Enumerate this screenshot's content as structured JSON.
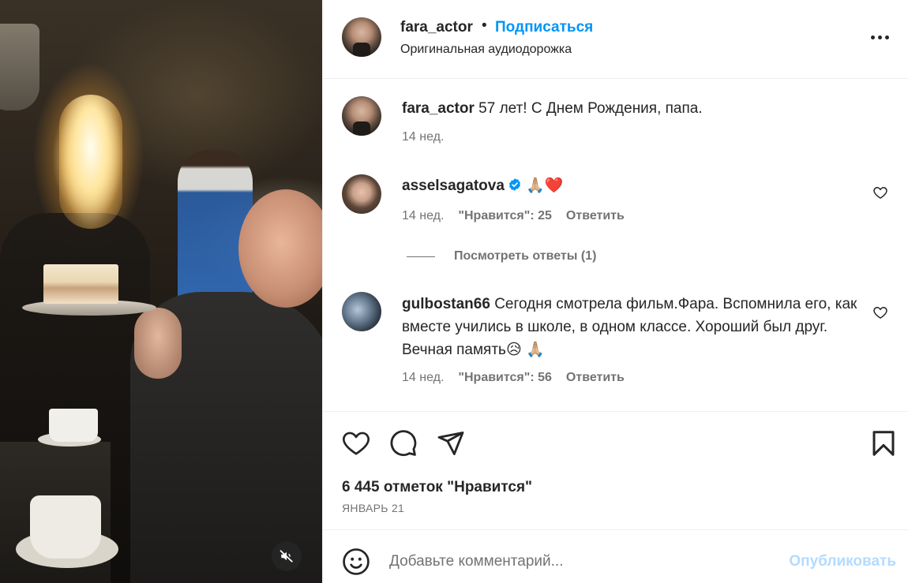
{
  "post": {
    "author": "fara_actor",
    "separator": "•",
    "follow_label": "Подписаться",
    "audio": "Оригинальная аудиодорожка",
    "caption": "57 лет! С Днем Рождения, папа.",
    "caption_time": "14 нед."
  },
  "comments": [
    {
      "user": "asselsagatova",
      "text": "🙏🏼❤️",
      "time": "14 нед.",
      "likes": "\"Нравится\": 25",
      "reply": "Ответить",
      "view_replies": "Посмотреть ответы (1)"
    },
    {
      "user": "gulbostan66",
      "text": "Сегодня смотрела фильм.Фара. Вспомнила его, как вместе учились в школе, в одном классе. Хороший был друг. Вечная память😥 🙏🏼",
      "time": "14 нед.",
      "likes": "\"Нравится\": 56",
      "reply": "Ответить"
    }
  ],
  "stats": {
    "likes": "6 445 отметок \"Нравится\"",
    "date": "ЯНВАРЬ 21"
  },
  "composer": {
    "placeholder": "Добавьте комментарий...",
    "publish": "Опубликовать"
  },
  "icons": {
    "more": "more-icon",
    "like": "heart-icon",
    "comment": "comment-icon",
    "share": "share-icon",
    "save": "bookmark-icon",
    "emoji": "emoji-icon",
    "mute": "muted-speaker-icon",
    "verified": "verified-badge-icon"
  },
  "colors": {
    "accent": "#0095f6",
    "publish_disabled": "#b3dbff",
    "muted_text": "#737373",
    "verified": "#0095f6"
  }
}
